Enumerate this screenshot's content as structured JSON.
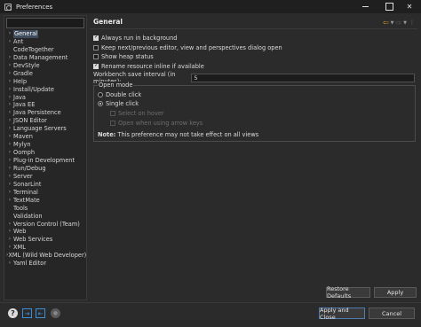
{
  "window": {
    "title": "Preferences"
  },
  "tree": {
    "items": [
      {
        "label": "General",
        "chevron": true,
        "selected": true
      },
      {
        "label": "Ant",
        "chevron": true
      },
      {
        "label": "CodeTogether",
        "chevron": false
      },
      {
        "label": "Data Management",
        "chevron": true
      },
      {
        "label": "DevStyle",
        "chevron": true
      },
      {
        "label": "Gradle",
        "chevron": true
      },
      {
        "label": "Help",
        "chevron": true
      },
      {
        "label": "Install/Update",
        "chevron": true
      },
      {
        "label": "Java",
        "chevron": true
      },
      {
        "label": "Java EE",
        "chevron": true
      },
      {
        "label": "Java Persistence",
        "chevron": true
      },
      {
        "label": "JSON Editor",
        "chevron": true
      },
      {
        "label": "Language Servers",
        "chevron": true
      },
      {
        "label": "Maven",
        "chevron": true
      },
      {
        "label": "Mylyn",
        "chevron": true
      },
      {
        "label": "Oomph",
        "chevron": true
      },
      {
        "label": "Plug-in Development",
        "chevron": true
      },
      {
        "label": "Run/Debug",
        "chevron": true
      },
      {
        "label": "Server",
        "chevron": true
      },
      {
        "label": "SonarLint",
        "chevron": true
      },
      {
        "label": "Terminal",
        "chevron": true
      },
      {
        "label": "TextMate",
        "chevron": true
      },
      {
        "label": "Tools",
        "chevron": false
      },
      {
        "label": "Validation",
        "chevron": false
      },
      {
        "label": "Version Control (Team)",
        "chevron": true
      },
      {
        "label": "Web",
        "chevron": true
      },
      {
        "label": "Web Services",
        "chevron": true
      },
      {
        "label": "XML",
        "chevron": true
      },
      {
        "label": "XML (Wild Web Developer)",
        "chevron": true
      },
      {
        "label": "Yaml Editor",
        "chevron": true
      }
    ]
  },
  "page": {
    "title": "General",
    "options": {
      "always_run_bg": {
        "label": "Always run in background",
        "checked": true
      },
      "keep_next_prev": {
        "label": "Keep next/previous editor, view and perspectives dialog open",
        "checked": false
      },
      "show_heap": {
        "label": "Show heap status",
        "checked": false
      },
      "rename_inline": {
        "label": "Rename resource inline if available",
        "checked": true
      }
    },
    "save_interval": {
      "label": "Workbench save interval (in minutes):",
      "value": "5"
    },
    "open_mode": {
      "legend": "Open mode",
      "double_click": "Double click",
      "single_click": "Single click",
      "selected": "single",
      "select_on_hover": "Select on hover",
      "open_arrow_keys": "Open when using arrow keys",
      "note_label": "Note:",
      "note_text": "This preference may not take effect on all views"
    },
    "buttons": {
      "restore": "Restore Defaults",
      "apply": "Apply"
    }
  },
  "footer": {
    "apply_close": "Apply and Close",
    "cancel": "Cancel"
  },
  "colors": {
    "accent": "#e59b2c",
    "link_blue": "#3b8ed8",
    "selection": "#3d4b5c"
  }
}
